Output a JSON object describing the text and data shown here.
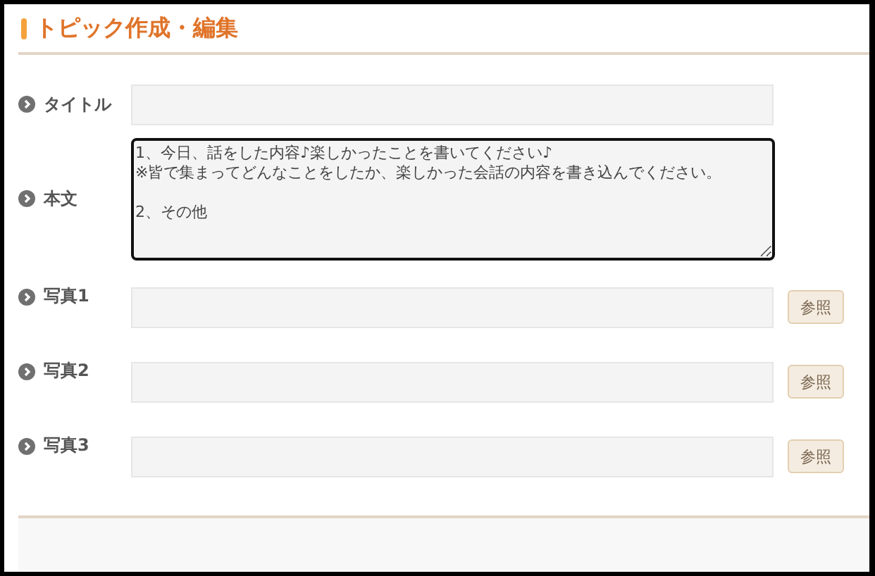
{
  "heading": "トピック作成・編集",
  "fields": [
    {
      "kind": "text",
      "label": "タイトル"
    },
    {
      "kind": "textarea",
      "label": "本文",
      "focused": true,
      "value": "1、今日、話をした内容♪楽しかったことを書いてください♪\n※皆で集まってどんなことをしたか、楽しかった会話の内容を書き込んでください。\n\n2、その他"
    },
    {
      "kind": "file",
      "label": "写真1",
      "button": "参照"
    },
    {
      "kind": "file",
      "label": "写真2",
      "button": "参照"
    },
    {
      "kind": "file",
      "label": "写真3",
      "button": "参照"
    }
  ]
}
